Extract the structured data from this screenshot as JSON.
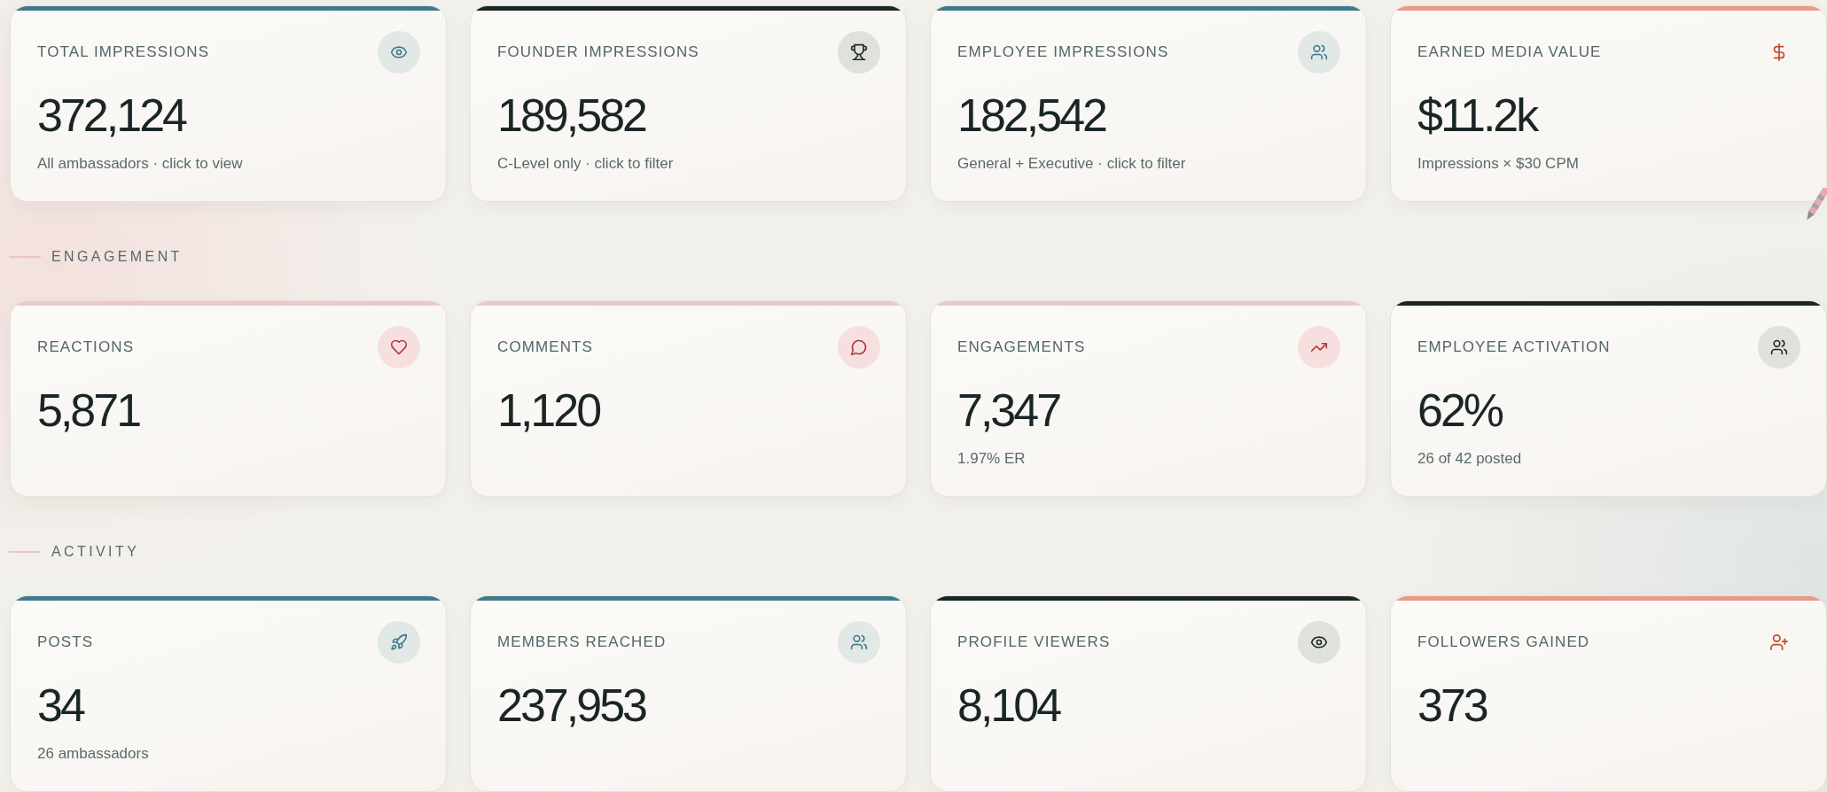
{
  "sections": [
    {
      "cards": [
        {
          "label": "TOTAL IMPRESSIONS",
          "value": "372,124",
          "note": "All ambassadors · click to view",
          "color": "#3f7a8b"
        },
        {
          "label": "FOUNDER IMPRESSIONS",
          "value": "189,582",
          "note": "C-Level only · click to filter",
          "color": "#1b2626"
        },
        {
          "label": "EMPLOYEE IMPRESSIONS",
          "value": "182,542",
          "note": "General + Executive · click to filter",
          "color": "#3f7a8b"
        },
        {
          "label": "EARNED MEDIA VALUE",
          "value": "$11.2k",
          "note": "Impressions × $30 CPM",
          "color": "#e99a88"
        }
      ]
    },
    {
      "title": "ENGAGEMENT",
      "cards": [
        {
          "label": "REACTIONS",
          "value": "5,871",
          "color": "#f1c6ca"
        },
        {
          "label": "COMMENTS",
          "value": "1,120",
          "color": "#f1c6ca"
        },
        {
          "label": "ENGAGEMENTS",
          "value": "7,347",
          "note": "1.97% ER",
          "color": "#f1c6ca"
        },
        {
          "label": "EMPLOYEE ACTIVATION",
          "value": "62%",
          "note": "26 of 42 posted",
          "color": "#1b2626"
        }
      ]
    },
    {
      "title": "ACTIVITY",
      "cards": [
        {
          "label": "POSTS",
          "value": "34",
          "note": "26 ambassadors",
          "color": "#3f7a8b"
        },
        {
          "label": "MEMBERS REACHED",
          "value": "237,953",
          "color": "#3f7a8b"
        },
        {
          "label": "PROFILE VIEWERS",
          "value": "8,104",
          "color": "#1b2626"
        },
        {
          "label": "FOLLOWERS GAINED",
          "value": "373",
          "color": "#e99a88"
        }
      ]
    }
  ]
}
